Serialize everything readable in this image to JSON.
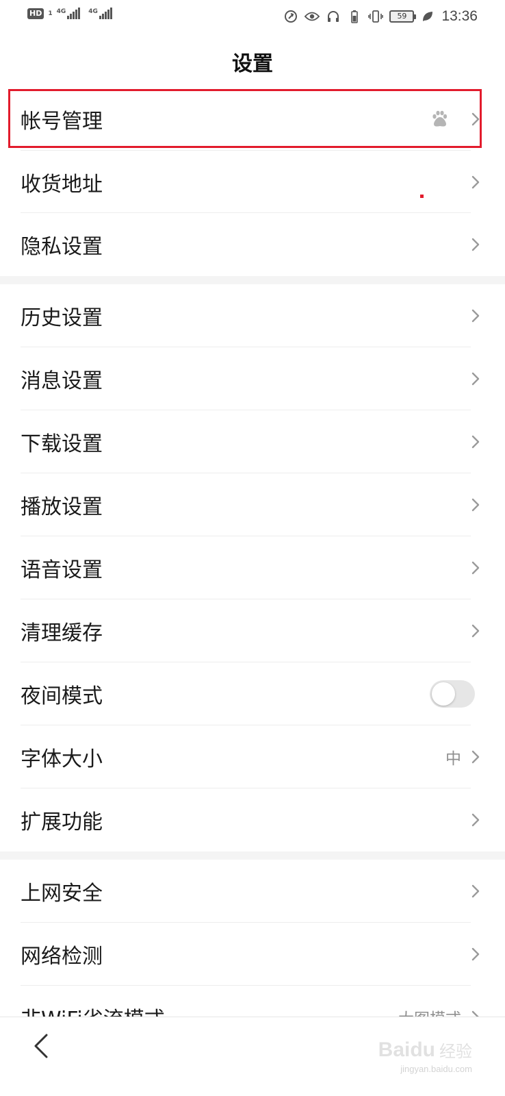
{
  "status_bar": {
    "hd_label": "HD",
    "hd_sub": "1",
    "signal_1_tag": "4G",
    "signal_2_tag": "4G",
    "battery_level": "59",
    "time": "13:36"
  },
  "header": {
    "title": "设置"
  },
  "settings": {
    "account": {
      "label": "帐号管理"
    },
    "address": {
      "label": "收货地址"
    },
    "privacy": {
      "label": "隐私设置"
    },
    "history": {
      "label": "历史设置"
    },
    "message": {
      "label": "消息设置"
    },
    "download": {
      "label": "下载设置"
    },
    "playback": {
      "label": "播放设置"
    },
    "voice": {
      "label": "语音设置"
    },
    "clear_cache": {
      "label": "清理缓存"
    },
    "night_mode": {
      "label": "夜间模式",
      "enabled": false
    },
    "font_size": {
      "label": "字体大小",
      "value": "中"
    },
    "extensions": {
      "label": "扩展功能"
    },
    "web_security": {
      "label": "上网安全"
    },
    "network_check": {
      "label": "网络检测"
    },
    "non_wifi_mode": {
      "label": "非WiFi省流模式",
      "value": "大图模式"
    }
  },
  "watermark": {
    "logo": "Baidu",
    "text": "经验",
    "url": "jingyan.baidu.com"
  },
  "colors": {
    "highlight": "#e21b2c",
    "chevron": "#9a9a9a",
    "section_gap": "#f4f4f4"
  }
}
